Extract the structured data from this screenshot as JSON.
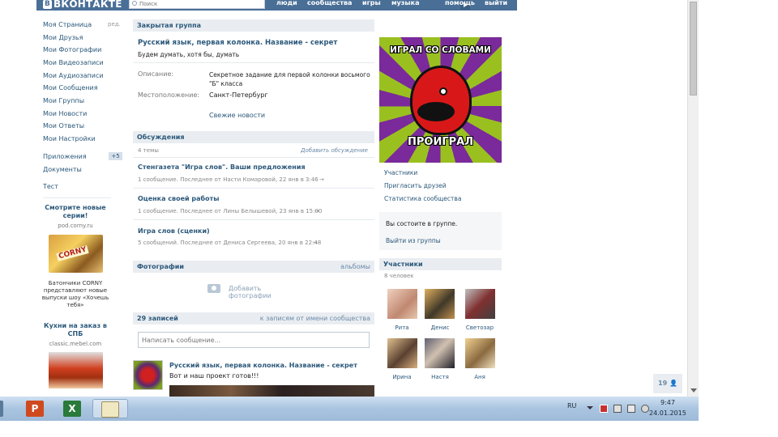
{
  "topbar": {
    "logo": "ВКОНТАКТЕ",
    "logo_badge": "В",
    "search_placeholder": "Поиск",
    "nav": [
      "люди",
      "сообщества",
      "игры",
      "музыка",
      "помощь",
      "выйти"
    ]
  },
  "leftmenu": {
    "items": [
      "Моя Страница",
      "Мои Друзья",
      "Мои Фотографии",
      "Мои Видеозаписи",
      "Мои Аудиозаписи",
      "Мои Сообщения",
      "Мои Группы",
      "Мои Новости",
      "Мои Ответы",
      "Мои Настройки"
    ],
    "edit_label": "ред.",
    "extra": [
      "Приложения",
      "Документы",
      "Тест"
    ],
    "apps_badge": "+5",
    "ads": [
      {
        "title": "Смотрите новые серии!",
        "url": "pod.corny.ru",
        "text": "Батончики CORNY представляют новые выпуски шоу «Хочешь тебя»"
      },
      {
        "title": "Кухни на заказ в СПБ",
        "url": "classic.mebel.com",
        "text": ""
      }
    ]
  },
  "group": {
    "type_label": "Закрытая группа",
    "title": "Русский язык, первая колонка. Название - секрет",
    "status": "Будем думать, хотя бы, думать",
    "desc_label": "Описание:",
    "desc_value": "Секретное задание для первой колонки восьмого \"Б\" класса",
    "location_label": "Местоположение:",
    "location_value": "Санкт-Петербург",
    "fresh_news": "Свежие новости"
  },
  "discussions": {
    "header": "Обсуждения",
    "count_label": "4 темы",
    "add_label": "Добавить обсуждение",
    "topics": [
      {
        "title": "Стенгазета \"Игра слов\". Ваши предложения",
        "meta": "1 сообщение. Последнее от Насти Комаровой, 22 янв в 3:46"
      },
      {
        "title": "Оценка своей работы",
        "meta": "1 сообщение. Последнее от Лины Белышевой, 23 янв в 15:00"
      },
      {
        "title": "Игра слов (сценки)",
        "meta": "5 сообщений. Последнее от Дениса Сергеева, 20 янв в 22:48"
      }
    ],
    "arrow": "→"
  },
  "photos": {
    "header": "Фотографии",
    "right": "альбомы",
    "add_label": "Добавить фотографии"
  },
  "wall": {
    "header": "29 записей",
    "right": "к записям от имени сообщества",
    "input_placeholder": "Написать сообщение...",
    "post_title": "Русский язык, первая колонка. Название - секрет",
    "post_text": "Вот и наш проект готов!!!"
  },
  "right": {
    "meme_top": "ИГРАЛ СО СЛОВАМИ",
    "meme_bottom": "ПРОИГРАЛ",
    "links": [
      "Участники",
      "Пригласить друзей",
      "Статистика сообщества"
    ],
    "member_status": "Вы состоите в группе.",
    "leave": "Выйти из группы",
    "members_header": "Участники",
    "members_count": "8 человек",
    "members": [
      "Рита",
      "Денис",
      "Светозар",
      "Ирина",
      "Настя",
      "Аня"
    ]
  },
  "like_count": "19",
  "taskbar": {
    "lang": "RU",
    "time": "9:47",
    "date": "24.01.2015"
  },
  "colors": {
    "vk_blue": "#4a6f97",
    "link": "#2b587a",
    "header_bg": "#e9edf1"
  }
}
